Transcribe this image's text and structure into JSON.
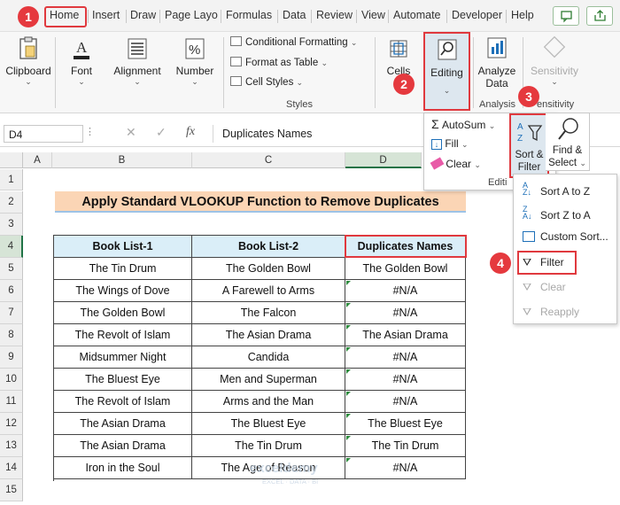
{
  "menu": {
    "tabs": [
      "Home",
      "Insert",
      "Draw",
      "Page Layo",
      "Formulas",
      "Data",
      "Review",
      "View",
      "Automate",
      "Developer",
      "Help"
    ]
  },
  "ribbon": {
    "clipboard": "Clipboard",
    "font": "Font",
    "alignment": "Alignment",
    "number": "Number",
    "conditional_formatting": "Conditional Formatting",
    "format_as_table": "Format as Table",
    "cell_styles": "Cell Styles",
    "styles_group": "Styles",
    "cells": "Cells",
    "editing": "Editing",
    "analyze_data": [
      "Analyze",
      "Data"
    ],
    "analysis_group": "Analysis",
    "sensitivity": "Sensitivity",
    "sensitivity_group": "ensitivity"
  },
  "editing_menu": {
    "autosum": "AutoSum",
    "fill": "Fill",
    "clear": "Clear",
    "sort_filter": [
      "Sort &",
      "Filter"
    ],
    "find_select": [
      "Find &",
      "Select"
    ],
    "group_label": "Editi"
  },
  "sort_menu": {
    "items": [
      "Sort A to Z",
      "Sort Z to A",
      "Custom Sort...",
      "Filter",
      "Clear",
      "Reapply"
    ]
  },
  "formula_bar": {
    "name_box": "D4",
    "fx": "fx",
    "content": "Duplicates Names"
  },
  "columns": [
    "A",
    "B",
    "C",
    "D"
  ],
  "rows": [
    "1",
    "2",
    "3",
    "4",
    "5",
    "6",
    "7",
    "8",
    "9",
    "10",
    "11",
    "12",
    "13",
    "14",
    "15"
  ],
  "sheet": {
    "title": "Apply Standard VLOOKUP Function to Remove Duplicates",
    "headers": [
      "Book List-1",
      "Book List-2",
      "Duplicates Names"
    ],
    "data": [
      [
        "The Tin Drum",
        "The Golden Bowl",
        "The Golden Bowl"
      ],
      [
        "The Wings of Dove",
        "A Farewell to Arms",
        "#N/A"
      ],
      [
        "The Golden Bowl",
        "The Falcon",
        "#N/A"
      ],
      [
        "The Revolt of Islam",
        "The Asian Drama",
        "The Asian Drama"
      ],
      [
        "Midsummer Night",
        "Candida",
        "#N/A"
      ],
      [
        "The Bluest Eye",
        "Men and Superman",
        "#N/A"
      ],
      [
        "The Revolt of Islam",
        "Arms and the Man",
        "#N/A"
      ],
      [
        "The Asian Drama",
        "The Bluest Eye",
        "The Bluest Eye"
      ],
      [
        "The Asian Drama",
        "The Tin Drum",
        "The Tin Drum"
      ],
      [
        "Iron in the Soul",
        "The Age of Reason",
        "#N/A"
      ]
    ]
  },
  "steps": [
    "1",
    "2",
    "3",
    "4"
  ],
  "watermark": {
    "name": "exceldemy",
    "tagline": "EXCEL · DATA · BI"
  },
  "colors": {
    "accent_red": "#e5393e",
    "header_fill": "#daeef8",
    "title_fill": "#fbd5b5"
  }
}
